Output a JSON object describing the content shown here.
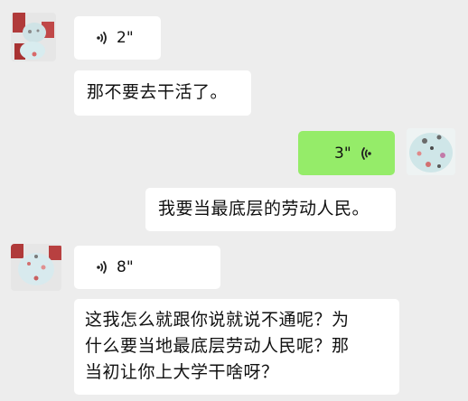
{
  "chat": {
    "messages": [
      {
        "side": "left",
        "type": "voice",
        "duration": "2\""
      },
      {
        "side": "left",
        "type": "text",
        "text": "那不要去干活了。"
      },
      {
        "side": "right",
        "type": "voice",
        "duration": "3\""
      },
      {
        "side": "right",
        "type": "text",
        "text": "我要当最底层的劳动人民。"
      },
      {
        "side": "left",
        "type": "voice",
        "duration": "8\""
      },
      {
        "side": "left",
        "type": "text",
        "lines": [
          "这我怎么就跟你说就说不通呢？为",
          "什么要当地最底层劳动人民呢？那",
          "当初让你上大学干啥呀？"
        ]
      }
    ]
  },
  "icons": {
    "voice_left": "voice-wave-icon",
    "voice_right": "voice-wave-icon",
    "avatar": "pixelated-avatar"
  },
  "colors": {
    "background": "#ededed",
    "bubble_received": "#ffffff",
    "bubble_sent": "#95ec69"
  }
}
